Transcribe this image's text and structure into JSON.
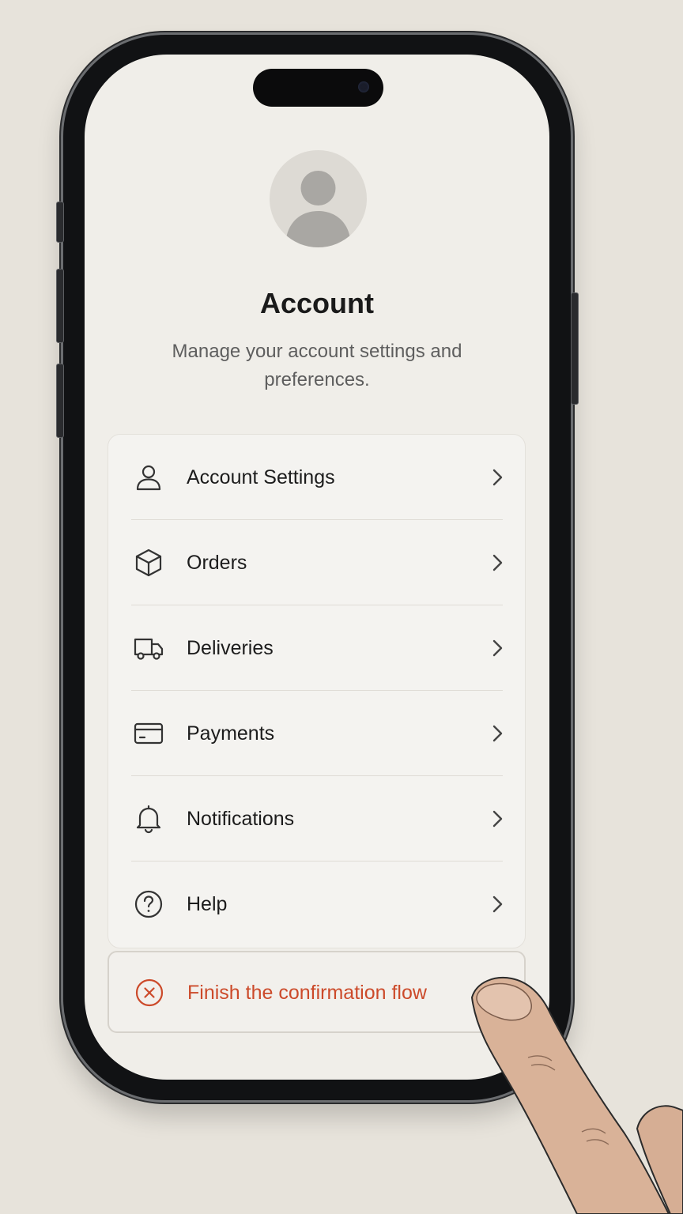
{
  "header": {
    "title": "Account",
    "subtitle": "Manage your account settings and preferences.",
    "avatar_icon": "person-silhouette-icon"
  },
  "menu": {
    "items": [
      {
        "label": "Account Settings",
        "icon": "user-icon"
      },
      {
        "label": "Orders",
        "icon": "box-icon"
      },
      {
        "label": "Deliveries",
        "icon": "truck-icon"
      },
      {
        "label": "Payments",
        "icon": "credit-card-icon"
      },
      {
        "label": "Notifications",
        "icon": "bell-icon"
      },
      {
        "label": "Help",
        "icon": "help-circle-icon"
      }
    ],
    "chevron_icon": "chevron-right-icon"
  },
  "confirm_action": {
    "label": "Finish the confirmation flow",
    "icon": "x-circle-icon"
  },
  "colors": {
    "screen_background": "#f0eee9",
    "card_background": "#f4f3f0",
    "text_primary": "#1c1c1c",
    "text_secondary": "#5e5e5e",
    "destructive_accent": "#cc4a2a",
    "device_frame": "#111214"
  }
}
